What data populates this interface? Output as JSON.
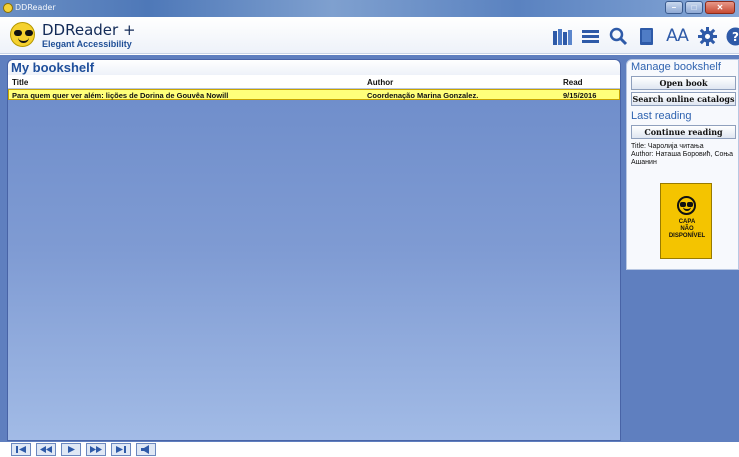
{
  "window": {
    "title": "DDReader",
    "buttons": {
      "minimize": "–",
      "maximize": "□",
      "close": "✕"
    }
  },
  "header": {
    "app_name": "DDReader +",
    "tagline": "Elegant Accessibility",
    "toolbar_icons": [
      "bookshelf-icon",
      "list-icon",
      "search-icon",
      "bookmark-icon",
      "font-size-icon",
      "settings-icon",
      "help-icon"
    ],
    "font_size_label": "AA"
  },
  "bookshelf": {
    "title": "My bookshelf",
    "columns": [
      "Title",
      "Author",
      "Read"
    ],
    "rows": [
      {
        "title": "Para quem quer ver além: lições de Dorina de Gouvêa Nowill",
        "author": "Coordenação Marina Gonzalez.",
        "read": "9/15/2016",
        "selected": true
      }
    ]
  },
  "manage": {
    "heading": "Manage bookshelf",
    "open_book": "Open book",
    "search_catalogs": "Search online catalogs"
  },
  "last_reading": {
    "heading": "Last reading",
    "continue_reading": "Continue reading",
    "book_title_line": "Title: Чаролија читања",
    "book_author_line": "Author: Наташа Боровић, Соња Ашанин",
    "cover_text_1": "CAPA",
    "cover_text_2": "NÃO",
    "cover_text_3": "DISPONÍVEL"
  },
  "player": {
    "buttons": [
      "skip-to-start-icon",
      "rewind-icon",
      "play-icon",
      "fast-forward-icon",
      "skip-to-end-icon",
      "speaker-icon"
    ]
  },
  "colors": {
    "accent": "#2e5aa8",
    "selected_row": "#ffff7a",
    "shelf_background": "#7f9bd3",
    "cover": "#f4c400"
  }
}
